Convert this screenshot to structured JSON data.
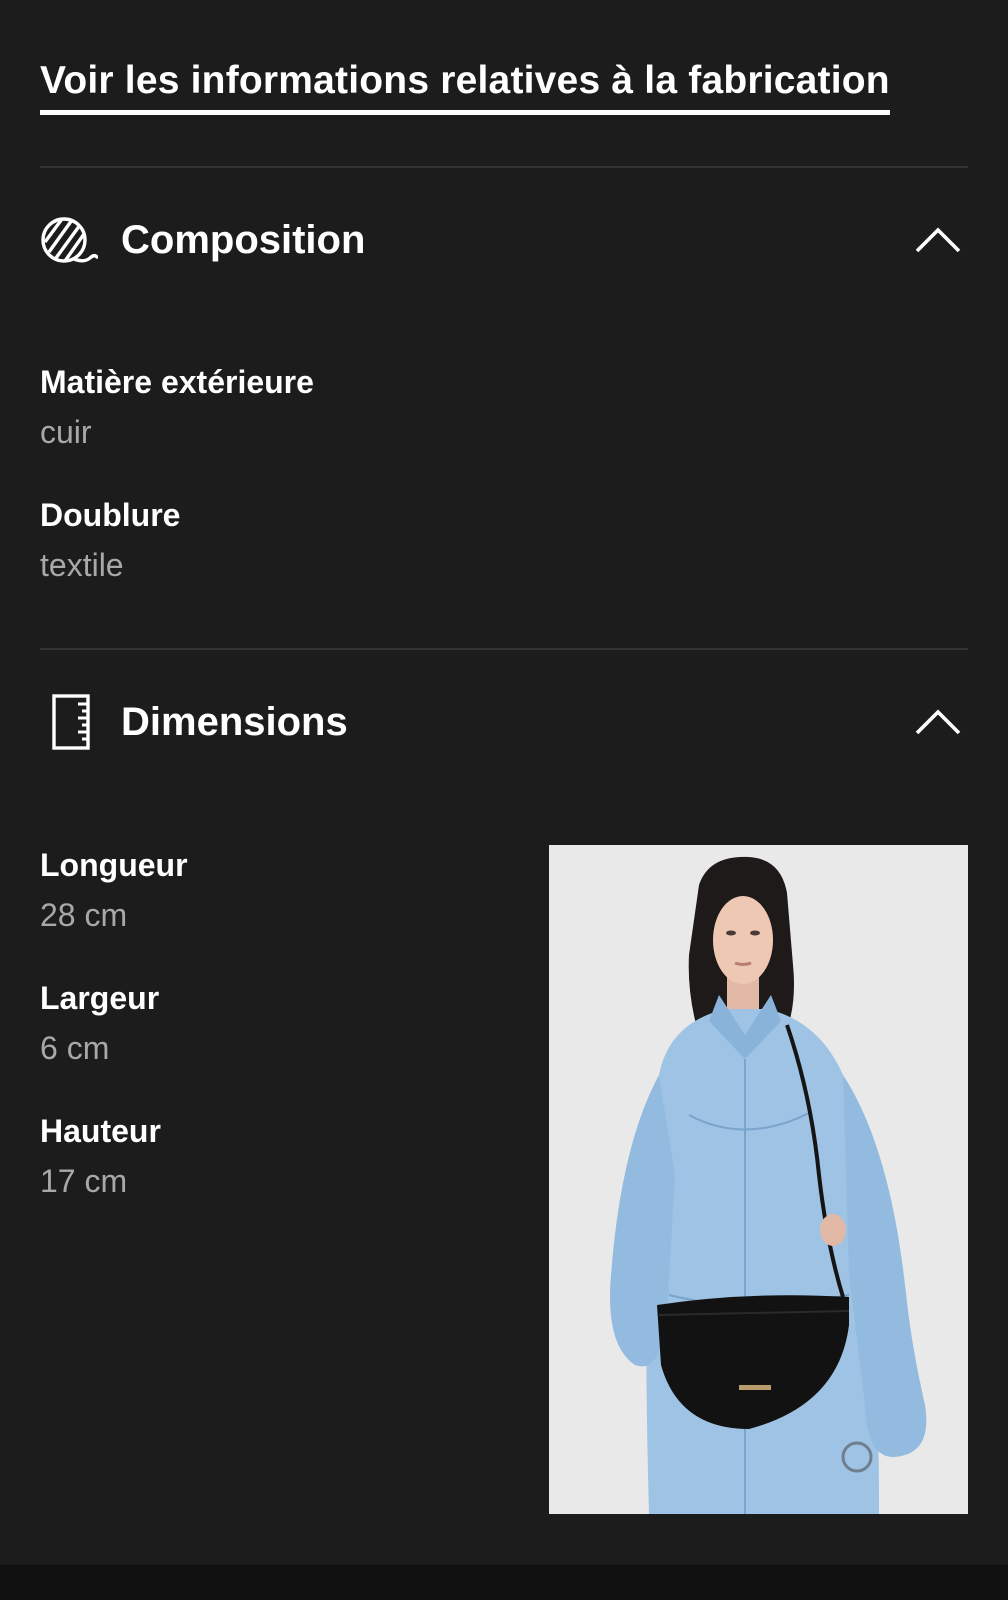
{
  "top": {
    "clipped_text": "    ",
    "fabrication_link": "Voir les informations relatives à la fabrication"
  },
  "composition": {
    "title": "Composition",
    "icon": "yarn-ball-icon",
    "expanded": true,
    "items": [
      {
        "label": "Matière extérieure",
        "value": "cuir"
      },
      {
        "label": "Doublure",
        "value": "textile"
      }
    ]
  },
  "dimensions": {
    "title": "Dimensions",
    "icon": "ruler-icon",
    "expanded": true,
    "items": [
      {
        "label": "Longueur",
        "value": "28 cm"
      },
      {
        "label": "Largeur",
        "value": "6 cm"
      },
      {
        "label": "Hauteur",
        "value": "17 cm"
      }
    ]
  },
  "colors": {
    "background": "#1c1c1c",
    "text_primary": "#ffffff",
    "text_secondary": "#a8a8a8",
    "divider": "#333333",
    "photo_background": "#e9e9e9",
    "denim": "#9ec3e4"
  }
}
